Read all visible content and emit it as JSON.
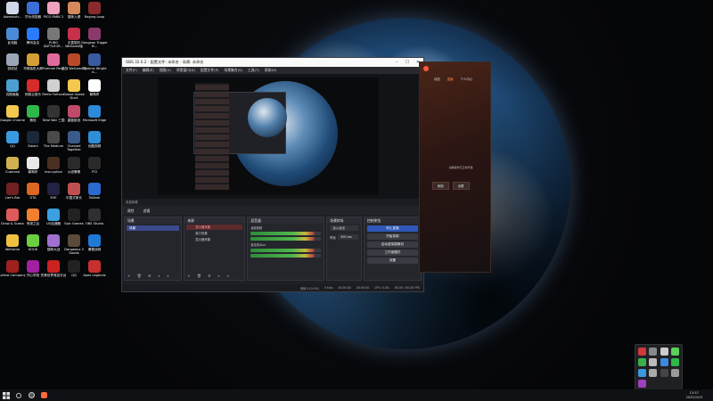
{
  "desktop_icons": [
    {
      "label": "Administr...",
      "color": "#cfd8e6"
    },
    {
      "label": "华为浏览器",
      "color": "#3c6fd6"
    },
    {
      "label": "PICO PARK 2",
      "color": "#f0a0c0"
    },
    {
      "label": "猫咪入侵",
      "color": "#d68a5c"
    },
    {
      "label": "Raging Loop",
      "color": "#8a2a2a"
    },
    {
      "label": "此电脑",
      "color": "#4b8ad6"
    },
    {
      "label": "腾讯会议",
      "color": "#2b7bff"
    },
    {
      "label": "PUBG BATTLEGR...",
      "color": "#777777"
    },
    {
      "label": "无畏契约 WeGame版",
      "color": "#c6304a"
    },
    {
      "label": "Dangeon Trigger M...",
      "color": "#8a3a6a"
    },
    {
      "label": "回收站",
      "color": "#9aa6b5"
    },
    {
      "label": "华硕装机大师",
      "color": "#d4a035"
    },
    {
      "label": "Pummel Party",
      "color": "#e06a9c"
    },
    {
      "label": "逆战 WeGame版",
      "color": "#b84a2a"
    },
    {
      "label": "Phoenix Wright A...",
      "color": "#3a5aa0"
    },
    {
      "label": "控制面板",
      "color": "#4aa0d0"
    },
    {
      "label": "网易云音乐",
      "color": "#d62b2b"
    },
    {
      "label": "Remo Fortune",
      "color": "#d0d0d0"
    },
    {
      "label": "Goose Goose Duck",
      "color": "#f2c94c"
    },
    {
      "label": "鹅鸭杀",
      "color": "#ffffff"
    },
    {
      "label": "Google Chrome",
      "color": "#f2c94c"
    },
    {
      "label": "微信",
      "color": "#2fb84a"
    },
    {
      "label": "Total War 三国",
      "color": "#333333"
    },
    {
      "label": "碧蓝航线",
      "color": "#c04a6a"
    },
    {
      "label": "Microsoft Edge",
      "color": "#2c8ad8"
    },
    {
      "label": "QQ",
      "color": "#3a9ae0"
    },
    {
      "label": "Steam",
      "color": "#1b2838"
    },
    {
      "label": "The Medium",
      "color": "#4a4a4a"
    },
    {
      "label": "Chained Together",
      "color": "#3a5a8a"
    },
    {
      "label": "优酷视频",
      "color": "#2f8fd6"
    },
    {
      "label": "Cuphead",
      "color": "#d0b050"
    },
    {
      "label": "鹅鸭杀",
      "color": "#e8e8e8"
    },
    {
      "label": "Inscryption",
      "color": "#4a3020"
    },
    {
      "label": "火线警察",
      "color": "#2a2a2a"
    },
    {
      "label": "FF2",
      "color": "#2a2a2a"
    },
    {
      "label": "Liar's Bar",
      "color": "#702020"
    },
    {
      "label": "GTA",
      "color": "#dd6622"
    },
    {
      "label": "EVE",
      "color": "#222244"
    },
    {
      "label": "中国式家长",
      "color": "#c05050"
    },
    {
      "label": "ToDesk",
      "color": "#2a6ad0"
    },
    {
      "label": "Draw & Guess",
      "color": "#e05a5a"
    },
    {
      "label": "有钱之后",
      "color": "#f08030"
    },
    {
      "label": "UU加速器",
      "color": "#3aa0e0"
    },
    {
      "label": "Epic Games",
      "color": "#222222"
    },
    {
      "label": "OBS Studio",
      "color": "#302e31"
    },
    {
      "label": "WeGame",
      "color": "#f0c040"
    },
    {
      "label": "KOOK",
      "color": "#6ad040"
    },
    {
      "label": "猫咪大战",
      "color": "#a070d0"
    },
    {
      "label": "Dangeons 3 Goods",
      "color": "#5a4a3a"
    },
    {
      "label": "暴雪战网",
      "color": "#1f7ad6"
    },
    {
      "label": "Lethal Company",
      "color": "#a02020"
    },
    {
      "label": "开心学苑",
      "color": "#a020a0"
    },
    {
      "label": "完美世界竞技平台",
      "color": "#cc2222"
    },
    {
      "label": "QQ",
      "color": "#222222"
    },
    {
      "label": "Apex Legends",
      "color": "#c83030"
    }
  ],
  "obs": {
    "title": "OBS 32.0.2 - 配置文件: 未命名 - 场景: 未命名",
    "menu": [
      "文件(F)",
      "编辑(E)",
      "视图(V)",
      "停靠窗口(D)",
      "配置文件(P)",
      "场景集合(S)",
      "工具(T)",
      "帮助(H)"
    ],
    "preview_status": "未选择源",
    "context_tabs": [
      "属性",
      "滤镜"
    ],
    "docks": {
      "scenes": {
        "title": "场景",
        "items": [
          "场景"
        ]
      },
      "sources": {
        "title": "来源",
        "items": [
          "显示器采集",
          "窗口采集",
          "显示器采集"
        ]
      },
      "mixer": {
        "title": "混音器",
        "channels": [
          {
            "name": "桌面音频",
            "level": "0.0 dB"
          },
          {
            "name": "麦克风/Aux",
            "level": "0.0 dB"
          }
        ]
      },
      "transitions": {
        "title": "场景转场",
        "type": "淡入淡出",
        "duration_label": "时长",
        "duration": "300 ms"
      },
      "controls": {
        "title": "控制按钮",
        "buttons": [
          "停止直播",
          "开始录制",
          "启动虚拟摄像机",
          "工作室模式",
          "设置",
          "退出"
        ]
      }
    },
    "status": {
      "dropped": "丢帧 0 (0.0%)",
      "kbps": "0 kb/s",
      "rec_time": "00:00:00",
      "stream_time": "00:00:00",
      "cpu": "CPU: 0.4%",
      "fps": "60.00 / 60.00 FPS"
    }
  },
  "app2": {
    "tabs": [
      "动态",
      "直播",
      "个人中心",
      "设置"
    ],
    "active_tab": "直播",
    "message": "请确保你已正常开播",
    "buttons": [
      "刷新",
      "设置"
    ]
  },
  "taskbar": {
    "time": "13:57",
    "date": "2025/10/3"
  }
}
